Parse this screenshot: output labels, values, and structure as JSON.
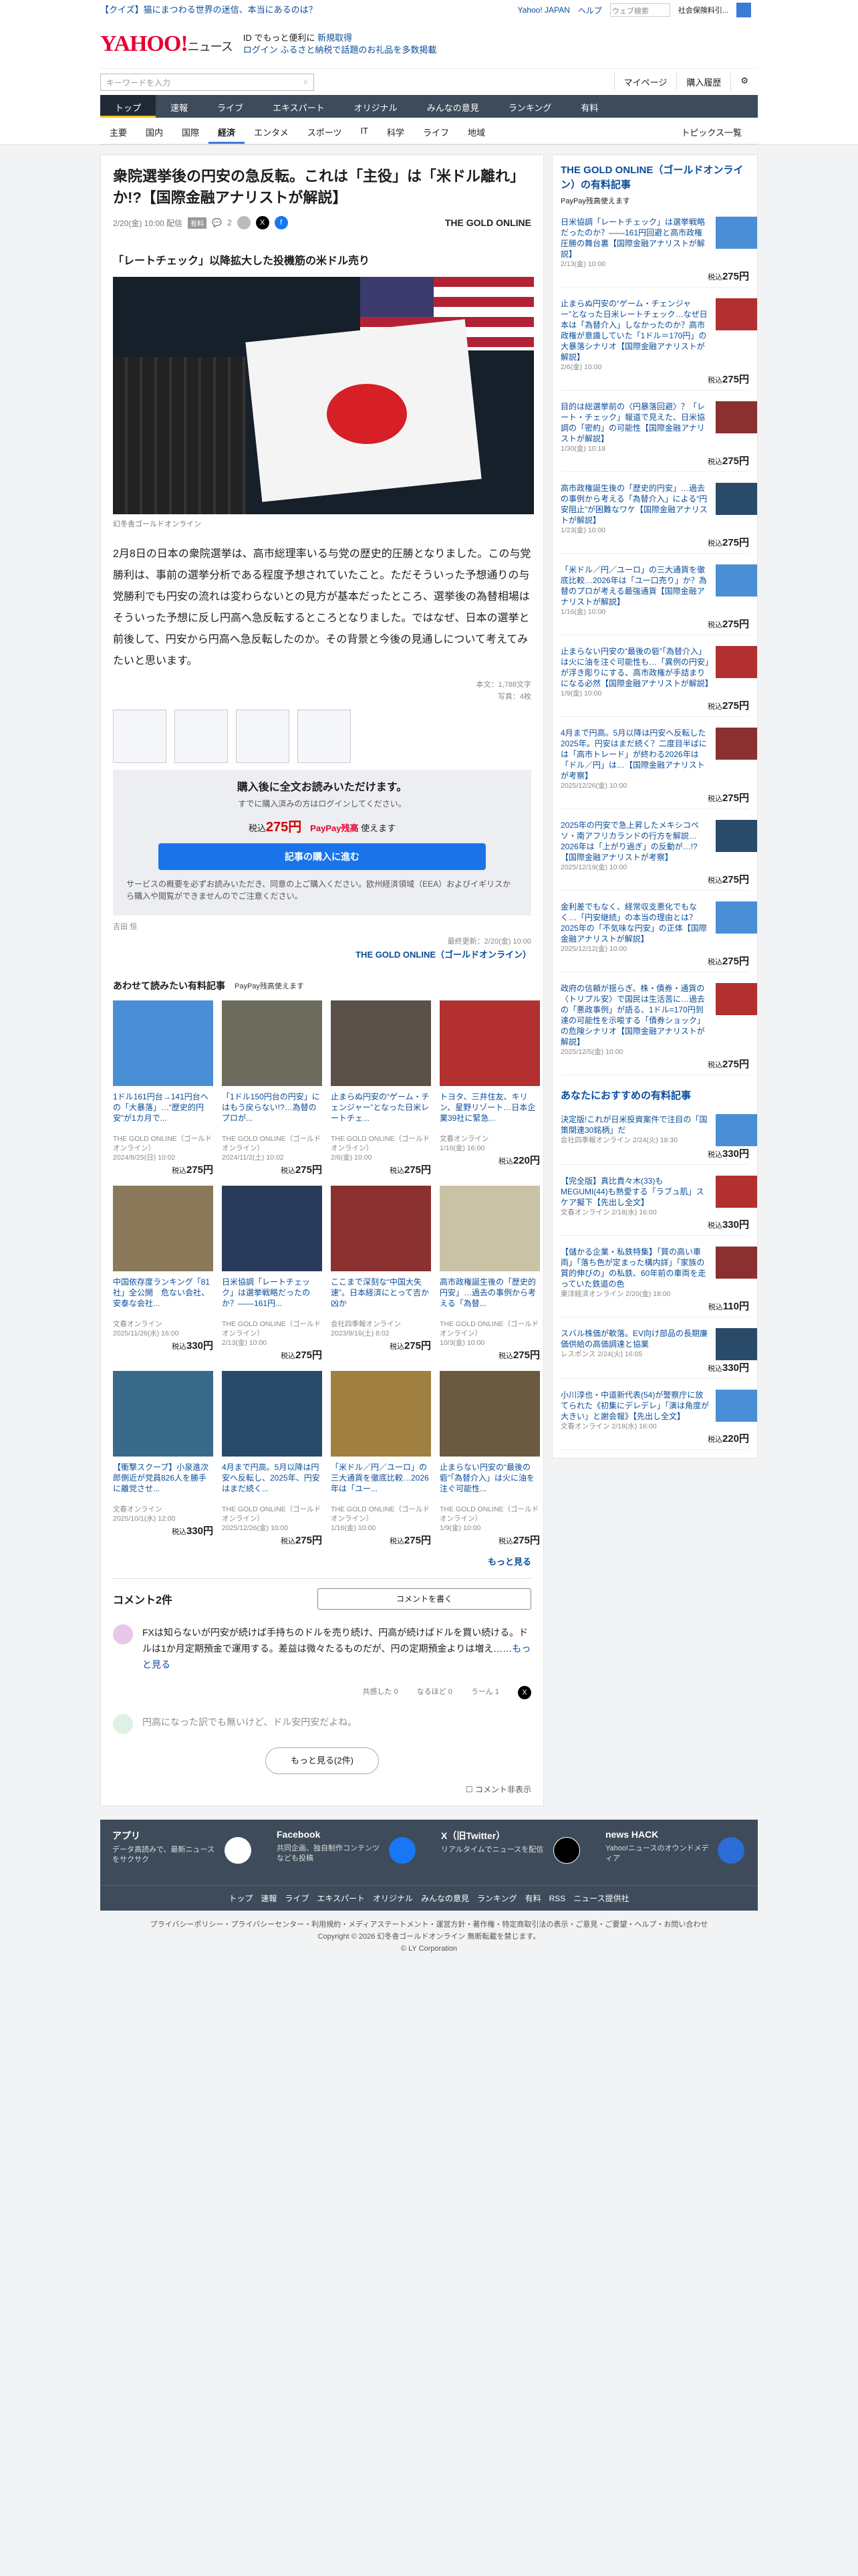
{
  "header": {
    "quiz": "【クイズ】猫にまつわる世界の迷信、本当にあるのは？",
    "yj_link": "Yahoo! JAPAN",
    "help": "ヘルプ",
    "mini_search": "ウェブ検索",
    "mini_search_right": "社会保険料引...",
    "logo": "YAHOO!",
    "logo_sub": "JAPAN",
    "service": "ニュース",
    "tagline": "ID でもっと便利に",
    "register": "新規取得",
    "login": "ログイン",
    "furusato": "ふるさと納税で話題のお礼品を多数掲載",
    "kw_placeholder": "キーワードを入力",
    "mypage": "マイページ",
    "purchased": "購入履歴"
  },
  "gnav": [
    "トップ",
    "速報",
    "ライブ",
    "エキスパート",
    "オリジナル",
    "みんなの意見",
    "ランキング",
    "有料"
  ],
  "snav": [
    "主要",
    "国内",
    "国際",
    "経済",
    "エンタメ",
    "スポーツ",
    "IT",
    "科学",
    "ライフ",
    "地域"
  ],
  "snav_right": "トピックス一覧",
  "article": {
    "title": "衆院選挙後の円安の急反転。これは「主役」は「米ドル離れ」か!?【国際金融アナリストが解説】",
    "date": "2/20(金) 10:00 配信",
    "paid_badge": "有料",
    "comments": "2",
    "brand": "THE GOLD ONLINE",
    "subtitle": "「レートチェック」以降拡大した投機筋の米ドル売り",
    "caption": "幻冬舎ゴールドオンライン",
    "body": "2月8日の日本の衆院選挙は、高市総理率いる与党の歴史的圧勝となりました。この与党勝利は、事前の選挙分析である程度予想されていたこと。ただそういった予想通りの与党勝利でも円安の流れは変わらないとの見方が基本だったところ、選挙後の為替相場はそういった予想に反し円高へ急反転するところとなりました。ではなぜ、日本の選挙と前後して、円安から円高へ急反転したのか。その背景と今後の見通しについて考えてみたいと思います。",
    "chars": "本文：1,788文字",
    "images": "写真：4枚",
    "buy_title": "購入後に全文お読みいただけます。",
    "buy_sub": "すでに購入済みの方はログインしてください。",
    "price_label": "税込",
    "price": "275円",
    "paypay": "PayPay残高",
    "paypay_use": "使えます",
    "buy_button": "記事の購入に進む",
    "notice": "サービスの概要を必ずお読みいただき、同意の上ご購入ください。欧州経済領域（EEA）およびイギリスから購入や閲覧ができませんのでご注意ください。",
    "author": "吉田 恒",
    "updated": "最終更新：2/20(金) 10:00",
    "brand_full": "THE GOLD ONLINE（ゴールドオンライン）"
  },
  "recommend": {
    "heading": "あわせて読みたい有料記事",
    "paypay_use": "PayPay残高使えます",
    "more": "もっと見る",
    "items": [
      {
        "title": "1ドル161円台→141円台への「大暴落」…“歴史的円安”が1カ月で...",
        "src": "THE GOLD ONLINE（ゴールドオンライン）",
        "date": "2024/8/25(日) 10:02",
        "price": "275円"
      },
      {
        "title": "「1ドル150円台の円安」にはもう戻らない!?…為替のプロが...",
        "src": "THE GOLD ONLINE（ゴールドオンライン）",
        "date": "2024/11/2(土) 10:02",
        "price": "275円"
      },
      {
        "title": "止まらぬ円安の“ゲーム・チェンジャー”となった日米レートチェ...",
        "src": "THE GOLD ONLINE（ゴールドオンライン）",
        "date": "2/6(金) 10:00",
        "price": "275円"
      },
      {
        "title": "トヨタ、三井住友、キリン、星野リゾート…日本企業39社に緊急...",
        "src": "文春オンライン",
        "date": "1/16(金) 16:00",
        "price": "220円"
      },
      {
        "title": "中国依存度ランキング「81社」全公開　危ない会社、安泰な会社...",
        "src": "文春オンライン",
        "date": "2025/11/26(水) 16:00",
        "price": "330円"
      },
      {
        "title": "日米協調「レートチェック」は選挙戦略だったのか？——161円...",
        "src": "THE GOLD ONLINE（ゴールドオンライン）",
        "date": "2/13(金) 10:00",
        "price": "275円"
      },
      {
        "title": "ここまで深刻な“中国大失速”。日本経済にとって吉か凶か",
        "src": "会社四季報オンライン",
        "date": "2023/9/16(土) 8:02",
        "price": "275円"
      },
      {
        "title": "高市政権誕生後の「歴史的円安」…過去の事例から考える「為替...",
        "src": "THE GOLD ONLINE（ゴールドオンライン）",
        "date": "10/3(金) 10:00",
        "price": "275円"
      },
      {
        "title": "【衝撃スクープ】小泉進次郎側近が党員826人を勝手に離党させ...",
        "src": "文春オンライン",
        "date": "2025/10/1(水) 12:00",
        "price": "330円"
      },
      {
        "title": "4月まで円高。5月以降は円安へ反転し、2025年、円安はまだ続く...",
        "src": "THE GOLD ONLINE（ゴールドオンライン）",
        "date": "2025/12/26(金) 10:00",
        "price": "275円"
      },
      {
        "title": "「米ドル／円／ユーロ」の三大通貨を徹底比較…2026年は「ユー...",
        "src": "THE GOLD ONLINE（ゴールドオンライン）",
        "date": "1/16(金) 10:00",
        "price": "275円"
      },
      {
        "title": "止まらない円安の“最後の砦”「為替介入」は火に油を注ぐ可能性...",
        "src": "THE GOLD ONLINE（ゴールドオンライン）",
        "date": "1/9(金) 10:00",
        "price": "275円"
      }
    ]
  },
  "comments": {
    "heading": "コメント",
    "count": "2件",
    "write": "コメントを書く",
    "c1": "FXは知らないが円安が続けば手持ちのドルを売り続け、円高が続けばドルを買い続ける。ドルは1か月定期預金で運用する。差益は微々たるものだが、円の定期預金よりは増え……",
    "more": "もっと見る",
    "agree": "共感した",
    "agree_n": "0",
    "nod": "なるほど",
    "nod_n": "0",
    "hmm": "うーん",
    "hmm_n": "1",
    "c2": "円高になった訳でも無いけど、ドル安円安だよね。",
    "more2": "もっと見る(2件)",
    "hide": "コメント非表示"
  },
  "side": {
    "heading": "THE GOLD ONLINE（ゴールドオンライン）の有料記事",
    "paypay": "PayPay残高使えます",
    "items": [
      {
        "t": "日米協調「レートチェック」は選挙戦略だったのか？——161円回避と高市政権圧勝の舞台裏【国際金融アナリストが解説】",
        "d": "2/13(金) 10:00",
        "p": "275円"
      },
      {
        "t": "止まらぬ円安の“ゲーム・チェンジャー”となった日米レートチェック…なぜ日本は「為替介入」しなかったのか？高市政権が意識していた「1ドル＝170円」の大暴落シナリオ【国際金融アナリストが解説】",
        "d": "2/6(金) 10:00",
        "p": "275円"
      },
      {
        "t": "目的は総選挙前の〈円暴落回避〉？「レート・チェック」報道で見えた、日米協調の「密約」の可能性【国際金融アナリストが解説】",
        "d": "1/30(金) 10:18",
        "p": "275円"
      },
      {
        "t": "高市政権誕生後の「歴史的円安」…過去の事例から考える「為替介入」による“円安阻止”が困難なワケ【国際金融アナリストが解説】",
        "d": "1/23(金) 10:00",
        "p": "275円"
      },
      {
        "t": "「米ドル／円／ユーロ」の三大通貨を徹底比較…2026年は「ユー口売り」か？為替のプロが考える最強通貨【国際金融アナリストが解説】",
        "d": "1/16(金) 10:00",
        "p": "275円"
      },
      {
        "t": "止まらない円安の“最後の砦”「為替介入」は火に油を注ぐ可能性も…「異例の円安」が浮き彫りにする、高市政権が手詰まりになる必然【国際金融アナリストが解説】",
        "d": "1/9(金) 10:00",
        "p": "275円"
      },
      {
        "t": "4月まで円高。5月以降は円安へ反転した2025年。円安はまだ続く？二度目半ばには「高市トレード」が終わる2026年は「ドル／円」は…【国際金融アナリストが考察】",
        "d": "2025/12/26(金) 10:00",
        "p": "275円"
      },
      {
        "t": "2025年の円安で急上昇したメキシコペソ・南アフリカランドの行方を解説…2026年は「上がり過ぎ」の反動が…!?【国際金融アナリストが考察】",
        "d": "2025/12/19(金) 10:00",
        "p": "275円"
      },
      {
        "t": "金利差でもなく、経常収支悪化でもなく…「円安継続」の本当の理由とは？2025年の「不気味な円安」の正体【国際金融アナリストが解説】",
        "d": "2025/12/12(金) 10:00",
        "p": "275円"
      },
      {
        "t": "政府の信頼が揺らぎ、株・債券・通貨の〈トリプル安〉で国民は生活苦に…過去の「悪政事例」が語る、1ドル=170円到達の可能性を示唆する「債券ショック」の危険シナリオ【国際金融アナリストが解説】",
        "d": "2025/12/5(金) 10:00",
        "p": "275円"
      }
    ],
    "heading2": "あなたにおすすめの有料記事",
    "items2": [
      {
        "t": "決定版!これが日米投資案件で注目の「国策関連30銘柄」だ",
        "d": "会社四季報オンライン 2/24(火) 18:30",
        "p": "330円"
      },
      {
        "t": "【完全版】真比貴々木(33)もMEGUMI(44)も熟愛する「ラブュ肌」スケア擬下【先出し全文】",
        "d": "文春オンライン 2/18(水) 16:00",
        "p": "330円"
      },
      {
        "t": "【儲かる企業・私鉄特集】「質の高い車両」「落ち色が定まった構内詳」「家族の質的伸びの」の私鉄、60年前の車両を走っていた鉄道の色",
        "d": "東洋経済オンライン 2/20(金) 18:00",
        "p": "110円"
      },
      {
        "t": "スバル株価が軟落。EV向け部品の長期廉価供給の高価調達と協業",
        "d": "レスポンス 2/24(火) 16:05",
        "p": "330円"
      },
      {
        "t": "小川淳也・中道新代表(54)が警察庁に放てられた《初集にデレデレ」「演は角度が大きい」と謝会報》【先出し全文】",
        "d": "文春オンライン 2/18(水) 16:00",
        "p": "220円"
      }
    ]
  },
  "footer": {
    "app": "アプリ",
    "app_d": "データ高読みで、最新ニュースをサクサク",
    "fb": "Facebook",
    "fb_d": "共同企画、独自制作コンテンツなども投稿",
    "x": "X（旧Twitter）",
    "x_d": "リアルタイムでニュースを配信",
    "hack": "news HACK",
    "hack_d": "Yahoo!ニュースのオウンドメディア",
    "links": "トップ　速報　ライブ　エキスパート　オリジナル　みんなの意見　ランキング　有料　RSS　ニュース提供社",
    "policy": "プライバシーポリシー・プライバシーセンター・利用規約・メディアステートメント・運営方針・著作権・特定商取引法の表示・ご意見・ご要望・ヘルプ・お問い合わせ",
    "copy1": "Copyright © 2026 幻冬舎ゴールドオンライン 無断転載を禁じます。",
    "copy2": "© LY Corporation"
  }
}
